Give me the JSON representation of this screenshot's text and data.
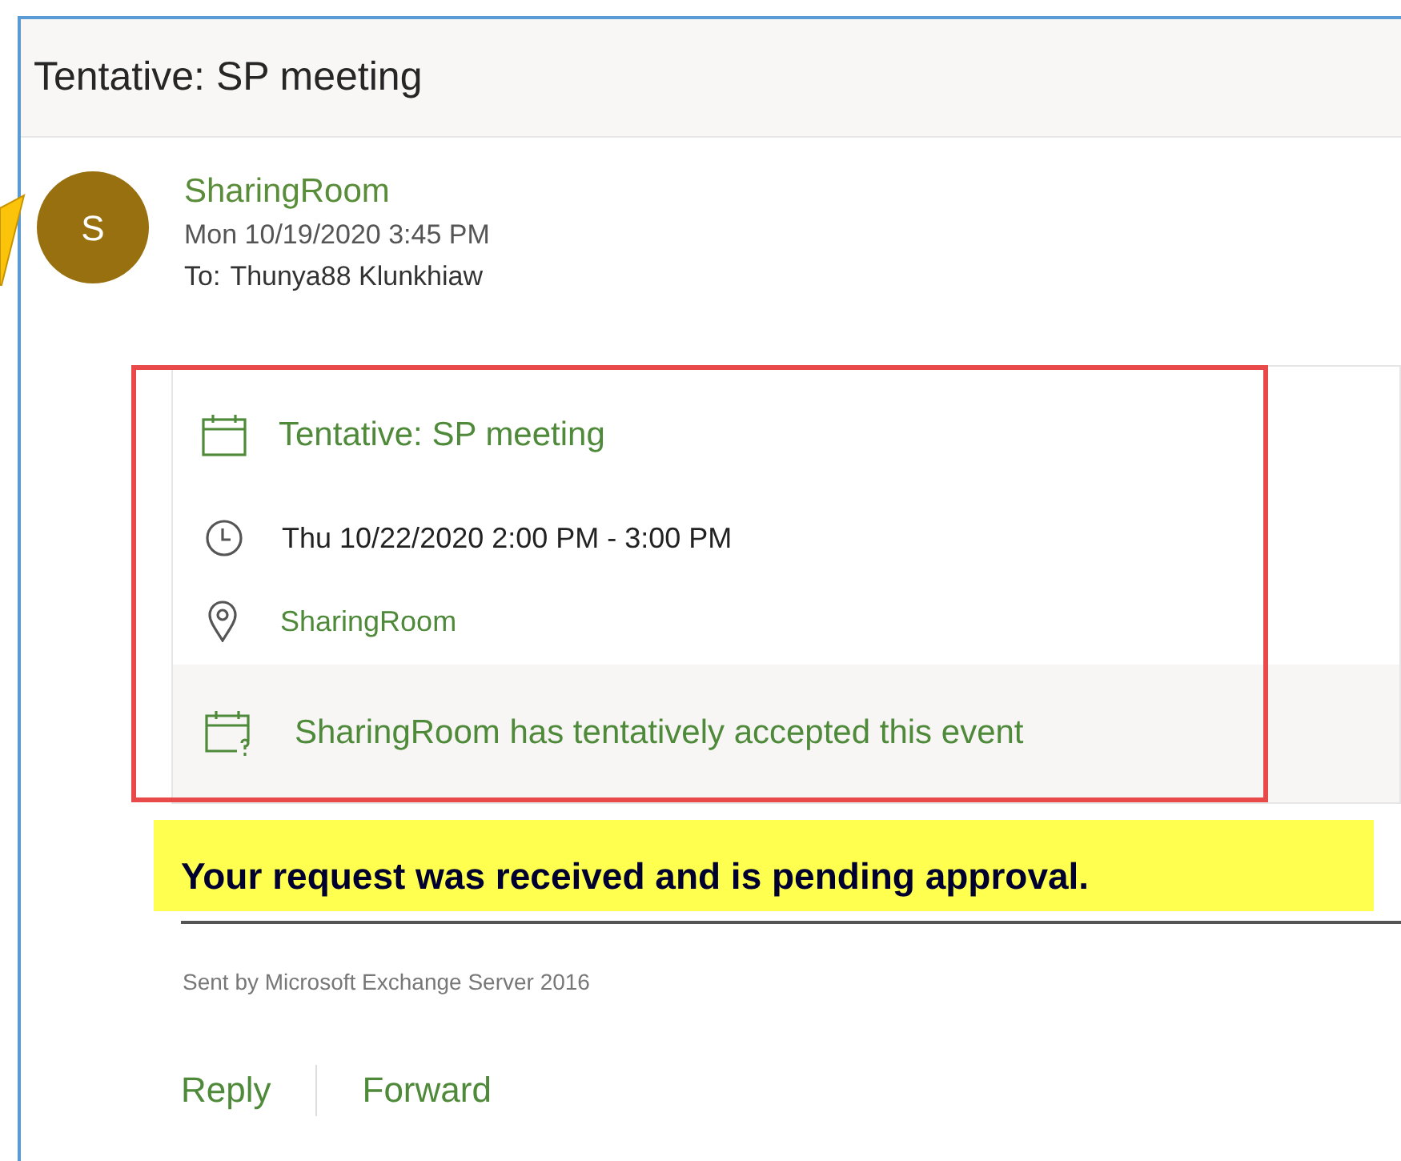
{
  "title": "Tentative: SP meeting",
  "sender": {
    "initial": "S",
    "name": "SharingRoom",
    "sent": "Mon 10/19/2020 3:45 PM",
    "to_label": "To:",
    "to": "Thunya88 Klunkhiaw"
  },
  "event": {
    "title": "Tentative: SP meeting",
    "time": "Thu 10/22/2020 2:00 PM - 3:00 PM",
    "location": "SharingRoom",
    "response": "SharingRoom has tentatively accepted this event"
  },
  "body": {
    "message": "Your request was received and is pending approval.",
    "footer": "Sent by Microsoft Exchange Server 2016"
  },
  "actions": [
    "Reply",
    "Forward"
  ]
}
